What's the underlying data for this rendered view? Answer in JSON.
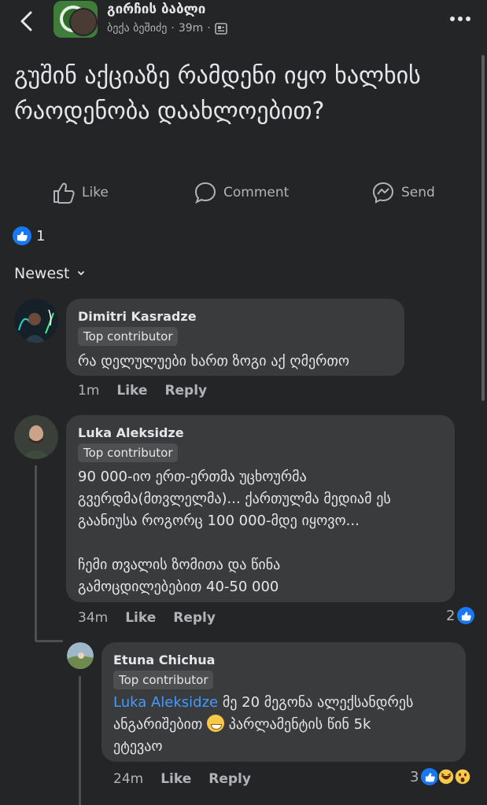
{
  "header": {
    "group_name": "გირჩის ბაბლი",
    "author": "ბექა ბეშიძე",
    "separator": "·",
    "time": "39m"
  },
  "post": {
    "text": "გუშინ აქციაზე რამდენი იყო ხალხის რაოდენობა დაახლოებით?"
  },
  "actions": {
    "like": "Like",
    "comment": "Comment",
    "send": "Send"
  },
  "reactions": {
    "count": "1"
  },
  "sort": {
    "label": "Newest"
  },
  "comments": [
    {
      "name": "Dimitri Kasradze",
      "badge": "Top contributor",
      "text": "რა დელულუები ხართ ზოგი აქ ღმერთო",
      "time": "1m",
      "like": "Like",
      "reply": "Reply"
    },
    {
      "name": "Luka Aleksidze",
      "badge": "Top contributor",
      "text_lines": [
        "90 000-იო ერთ-ერთმა უცხოურმა",
        "გვერდმა(მთვლელმა)... ქართულმა მედიამ ეს",
        "გაანიუსა როგორც 100 000-მდე იყოვო...",
        "",
        "ჩემი თვალის ზომითა და წინა",
        "გამოცდილებებით 40-50 000"
      ],
      "time": "34m",
      "like": "Like",
      "reply": "Reply",
      "reaction_count": "2"
    },
    {
      "name": "Etuna Chichua",
      "badge": "Top contributor",
      "mention": "Luka Aleksidze",
      "text_line1": " მე 20 მეგონა ალექსანდრეს",
      "text_line2a": "ანგარიშებით ",
      "text_line2b": " პარლამენტის წინ 5k",
      "text_line3": "ეტევაო",
      "time": "24m",
      "like": "Like",
      "reply": "Reply",
      "reaction_count": "3"
    }
  ],
  "colors": {
    "background": "#242526",
    "bubble": "#3a3b3c",
    "accent": "#1877f2",
    "mention": "#4599ff"
  }
}
